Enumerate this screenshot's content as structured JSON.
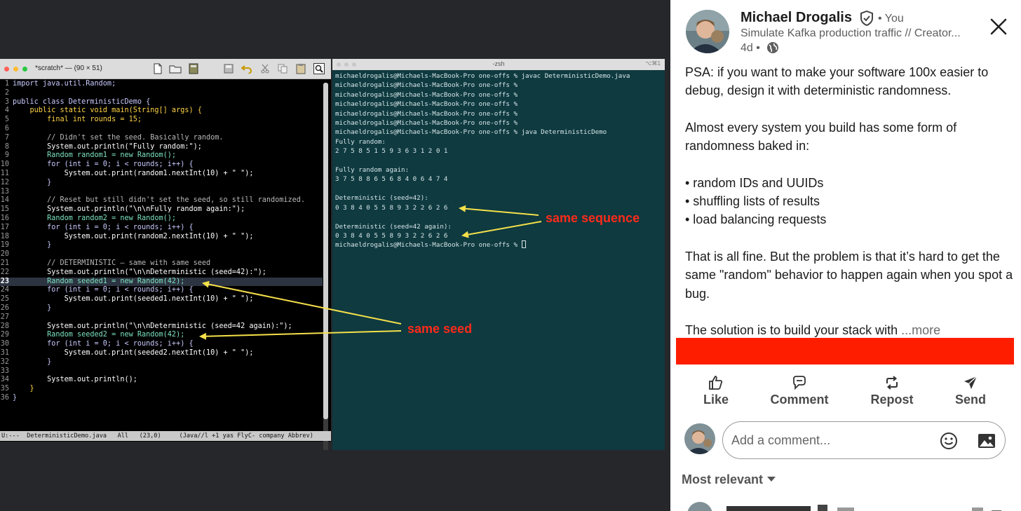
{
  "editor": {
    "title": "*scratch* — (90 × 51)",
    "current_line": 23,
    "lines": [
      {
        "n": "1",
        "t": "import java.util.Random;",
        "c": "kw"
      },
      {
        "n": "2",
        "t": "",
        "c": "mix"
      },
      {
        "n": "3",
        "t": "public class DeterministicDemo {",
        "c": "kw"
      },
      {
        "n": "4",
        "t": "    public static void main(String[] args) {",
        "c": "ylw"
      },
      {
        "n": "5",
        "t": "        final int rounds = 15;",
        "c": "ylw"
      },
      {
        "n": "6",
        "t": "",
        "c": "mix"
      },
      {
        "n": "7",
        "t": "        // Didn't set the seed. Basically random.",
        "c": "com"
      },
      {
        "n": "8",
        "t": "        System.out.println(\"Fully random:\");",
        "c": "str"
      },
      {
        "n": "9",
        "t": "        Random random1 = new Random();",
        "c": "typ"
      },
      {
        "n": "10",
        "t": "        for (int i = 0; i < rounds; i++) {",
        "c": "kw"
      },
      {
        "n": "11",
        "t": "            System.out.print(random1.nextInt(10) + \" \");",
        "c": "str"
      },
      {
        "n": "12",
        "t": "        }",
        "c": "kw"
      },
      {
        "n": "13",
        "t": "",
        "c": "mix"
      },
      {
        "n": "14",
        "t": "        // Reset but still didn't set the seed, so still randomized.",
        "c": "com"
      },
      {
        "n": "15",
        "t": "        System.out.println(\"\\n\\nFully random again:\");",
        "c": "str"
      },
      {
        "n": "16",
        "t": "        Random random2 = new Random();",
        "c": "typ"
      },
      {
        "n": "17",
        "t": "        for (int i = 0; i < rounds; i++) {",
        "c": "kw"
      },
      {
        "n": "18",
        "t": "            System.out.print(random2.nextInt(10) + \" \");",
        "c": "str"
      },
      {
        "n": "19",
        "t": "        }",
        "c": "kw"
      },
      {
        "n": "20",
        "t": "",
        "c": "mix"
      },
      {
        "n": "21",
        "t": "        // DETERMINISTIC — same with same seed",
        "c": "com"
      },
      {
        "n": "22",
        "t": "        System.out.println(\"\\n\\nDeterministic (seed=42):\");",
        "c": "str"
      },
      {
        "n": "23",
        "t": "        Random seeded1 = new Random(42);",
        "c": "typ"
      },
      {
        "n": "24",
        "t": "        for (int i = 0; i < rounds; i++) {",
        "c": "kw"
      },
      {
        "n": "25",
        "t": "            System.out.print(seeded1.nextInt(10) + \" \");",
        "c": "str"
      },
      {
        "n": "26",
        "t": "        }",
        "c": "kw"
      },
      {
        "n": "27",
        "t": "",
        "c": "mix"
      },
      {
        "n": "28",
        "t": "        System.out.println(\"\\n\\nDeterministic (seed=42 again):\");",
        "c": "str"
      },
      {
        "n": "29",
        "t": "        Random seeded2 = new Random(42);",
        "c": "typ"
      },
      {
        "n": "30",
        "t": "        for (int i = 0; i < rounds; i++) {",
        "c": "kw"
      },
      {
        "n": "31",
        "t": "            System.out.print(seeded2.nextInt(10) + \" \");",
        "c": "str"
      },
      {
        "n": "32",
        "t": "        }",
        "c": "kw"
      },
      {
        "n": "33",
        "t": "",
        "c": "mix"
      },
      {
        "n": "34",
        "t": "        System.out.println();",
        "c": "str"
      },
      {
        "n": "35",
        "t": "    }",
        "c": "ylw"
      },
      {
        "n": "36",
        "t": "}",
        "c": "kw"
      }
    ],
    "modeline": "U:---  DeterministicDemo.java   All   (23,0)     (Java//l +1 yas FlyC- company Abbrev)"
  },
  "terminal": {
    "title": "-zsh",
    "shortcut": "⌥⌘1",
    "lines": [
      "michaeldrogalis@Michaels-MacBook-Pro one-offs % javac DeterministicDemo.java",
      "michaeldrogalis@Michaels-MacBook-Pro one-offs %",
      "michaeldrogalis@Michaels-MacBook-Pro one-offs %",
      "michaeldrogalis@Michaels-MacBook-Pro one-offs %",
      "michaeldrogalis@Michaels-MacBook-Pro one-offs %",
      "michaeldrogalis@Michaels-MacBook-Pro one-offs %",
      "michaeldrogalis@Michaels-MacBook-Pro one-offs % java DeterministicDemo",
      "Fully random:",
      "2 7 5 8 5 1 5 9 3 6 3 1 2 0 1",
      "",
      "Fully random again:",
      "3 7 5 8 8 6 5 6 8 4 0 6 4 7 4",
      "",
      "Deterministic (seed=42):",
      "0 3 8 4 0 5 5 8 9 3 2 2 6 2 6",
      "",
      "Deterministic (seed=42 again):",
      "0 3 8 4 0 5 5 8 9 3 2 2 6 2 6"
    ],
    "prompt": "michaeldrogalis@Michaels-MacBook-Pro one-offs % "
  },
  "annotations": {
    "same_sequence": "same sequence",
    "same_seed": "same seed",
    "arrow_color": "#f5e04a",
    "label_color": "#ff2a1a"
  },
  "post": {
    "author": "Michael Drogalis",
    "you": "• You",
    "headline": "Simulate Kafka production traffic // Creator...",
    "time": "4d •",
    "paragraphs": [
      "PSA: if you want to make your software 100x easier to debug, design it with deterministic randomness.",
      "Almost every system you build has some form of randomness baked in:"
    ],
    "bullets": [
      "• random IDs and UUIDs",
      "• shuffling lists of results",
      "• load balancing requests"
    ],
    "paragraph3": "That is all fine. But the problem is that it’s hard to get the same \"random\" behavior to happen again when you spot a bug.",
    "last_line": "The solution is to build your stack with  ",
    "more": "...more",
    "redaction_color": "#ff1d00"
  },
  "actions": {
    "like": "Like",
    "comment": "Comment",
    "repost": "Repost",
    "send": "Send"
  },
  "comment_box": {
    "placeholder": "Add a comment..."
  },
  "sort": {
    "label": "Most relevant"
  },
  "icons": [
    "verified-shield-icon",
    "globe-icon",
    "close-icon",
    "like-icon",
    "comment-icon",
    "repost-icon",
    "send-icon",
    "emoji-icon",
    "photo-icon",
    "caret-down-icon"
  ]
}
